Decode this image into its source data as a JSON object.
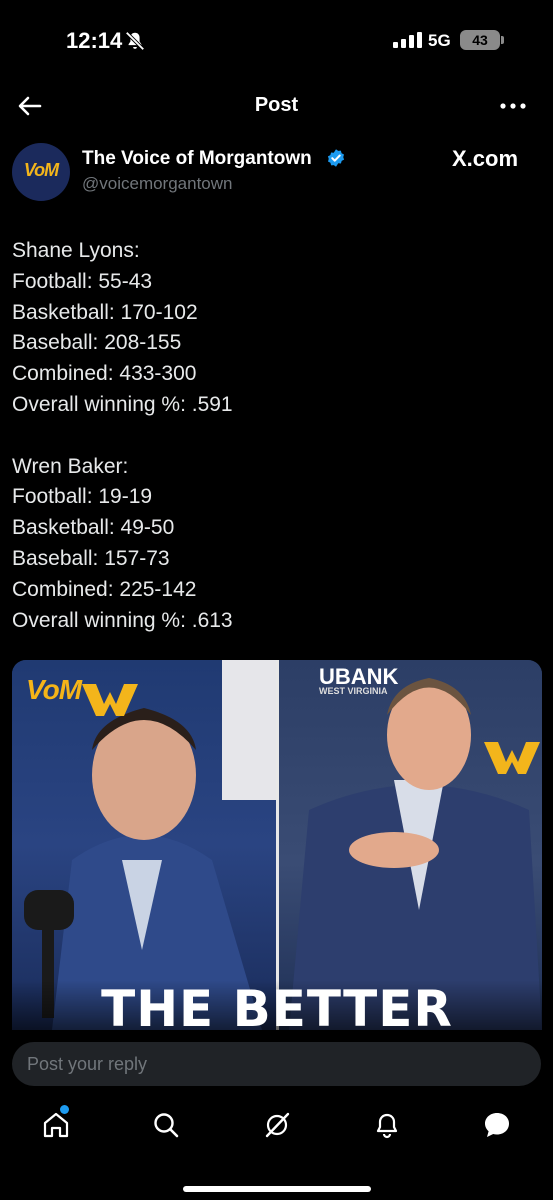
{
  "status": {
    "time": "12:14",
    "network": "5G",
    "battery": "43"
  },
  "header": {
    "title": "Post"
  },
  "author": {
    "avatar_text": "VoM",
    "name": "The Voice of Morgantown",
    "handle": "@voicemorgantown",
    "source": "X.com"
  },
  "post": {
    "lines": [
      "Shane Lyons:",
      "Football: 55-43",
      "Basketball: 170-102",
      "Baseball: 208-155",
      "Combined: 433-300",
      "Overall winning %: .591",
      "",
      "Wren Baker:",
      "Football: 19-19",
      "Basketball: 49-50",
      "Baseball: 157-73",
      "Combined: 225-142",
      "Overall winning %: .613"
    ]
  },
  "image": {
    "logo": "VoM",
    "bank_text": "UBANK",
    "bank_sub": "WEST VIRGINIA",
    "headline": "THE BETTER"
  },
  "reply": {
    "placeholder": "Post your reply"
  },
  "bottom_nav": {
    "items": [
      "home-icon",
      "search-icon",
      "grok-icon",
      "notifications-icon",
      "messages-icon"
    ]
  },
  "colors": {
    "background": "#000000",
    "text": "#e7e9ea",
    "muted": "#71767b",
    "accent": "#1d9bf0",
    "wvu_gold": "#f3b51b",
    "wvu_blue": "#1b2a5c"
  }
}
